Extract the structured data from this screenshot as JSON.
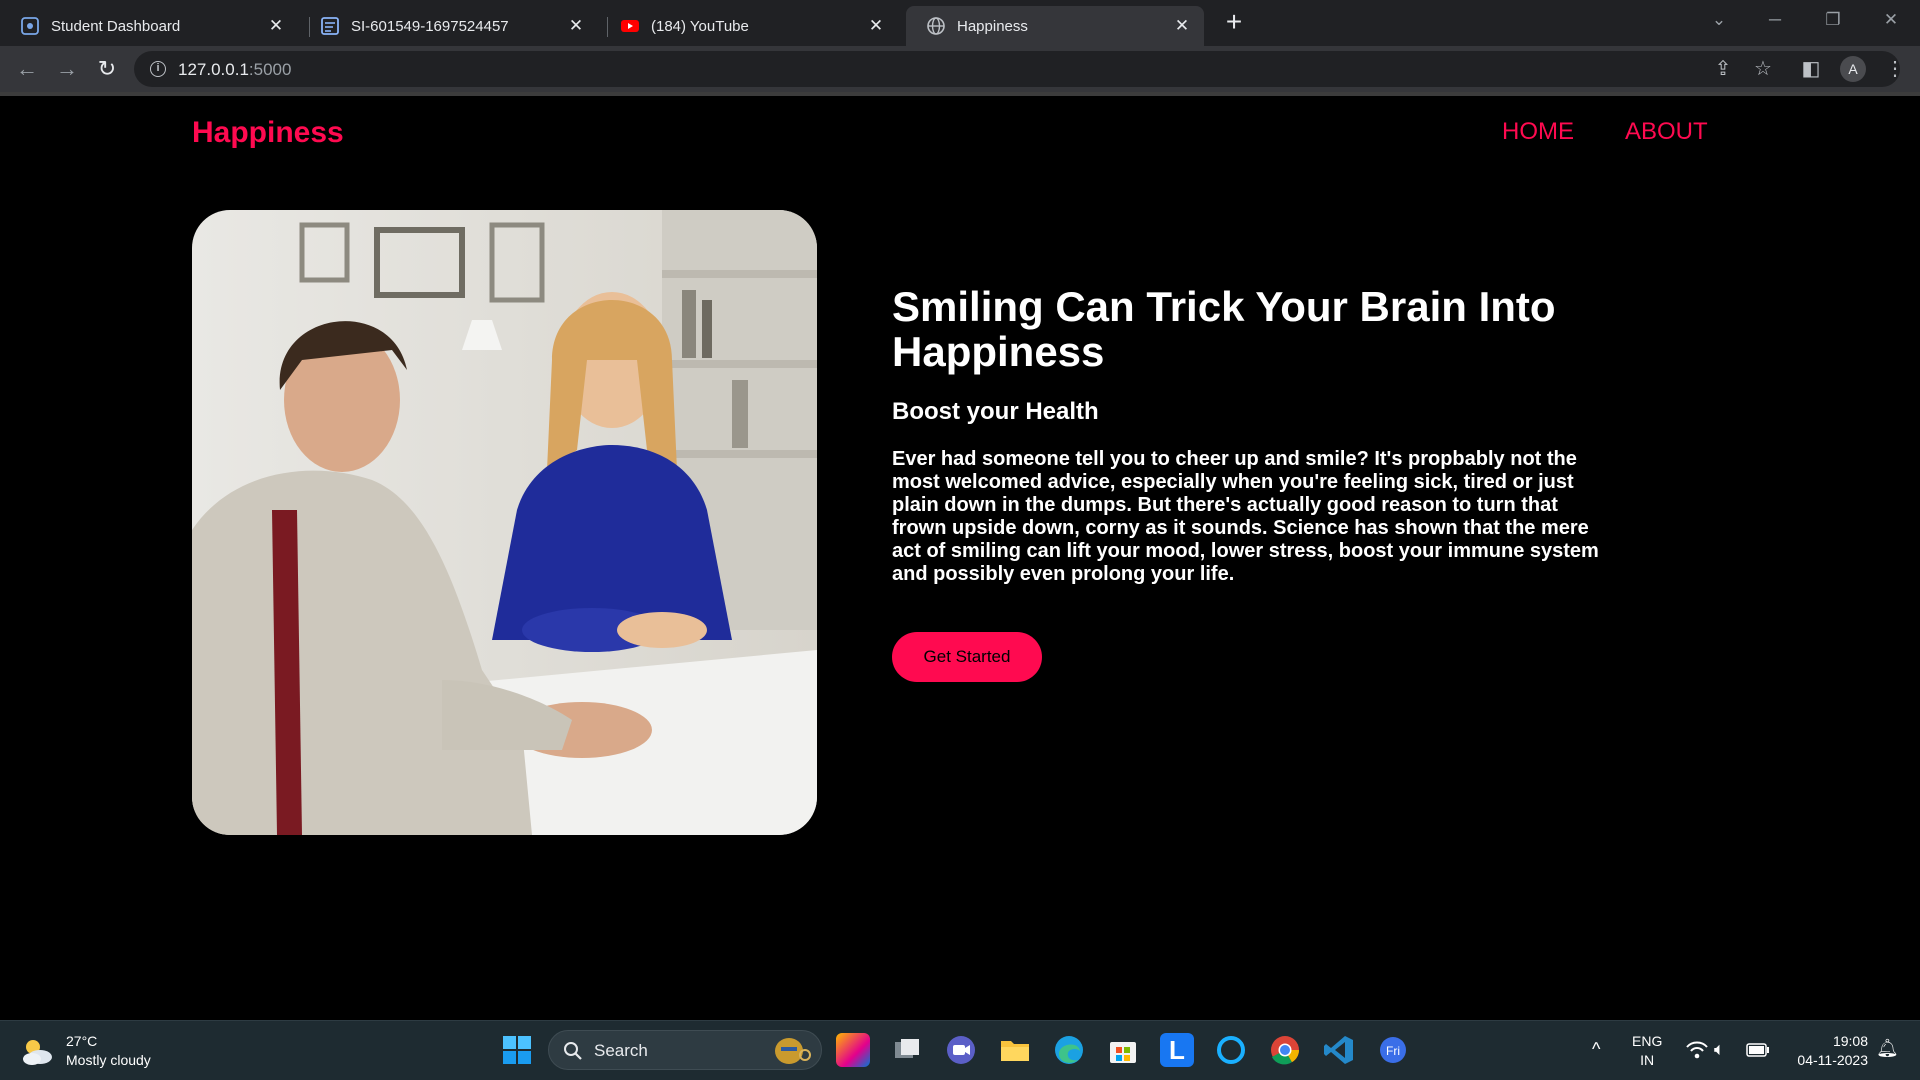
{
  "browser": {
    "tabs": [
      {
        "title": "Student Dashboard",
        "favicon": "dashboard-icon",
        "active": false
      },
      {
        "title": "SI-601549-1697524457",
        "favicon": "document-icon",
        "active": false
      },
      {
        "title": "(184) YouTube",
        "favicon": "youtube-icon",
        "active": false
      },
      {
        "title": "Happiness",
        "favicon": "globe-icon",
        "active": true
      }
    ],
    "address": {
      "host": "127.0.0.1",
      "port": ":5000"
    },
    "profile_initial": "A"
  },
  "site": {
    "logo": "Happiness",
    "nav": [
      "HOME",
      "ABOUT"
    ],
    "hero": {
      "title": "Smiling Can Trick Your Brain Into Happiness",
      "subtitle": "Boost your Health",
      "body": "Ever had someone tell you to cheer up and smile? It's propbably not the most welcomed advice, especially when you're feeling sick, tired or just plain down in the dumps. But there's actually good reason to turn that frown upside down, corny as it sounds. Science has shown that the mere act of smiling can lift your mood, lower stress, boost your immune system and possibly even prolong your life.",
      "cta": "Get Started",
      "image": "business-meeting-photo"
    },
    "accent_color": "#ff0a50"
  },
  "taskbar": {
    "weather": {
      "temp": "27°C",
      "condition": "Mostly cloudy"
    },
    "search_label": "Search",
    "language": {
      "line1": "ENG",
      "line2": "IN"
    },
    "time": "19:08",
    "date": "04-11-2023"
  }
}
